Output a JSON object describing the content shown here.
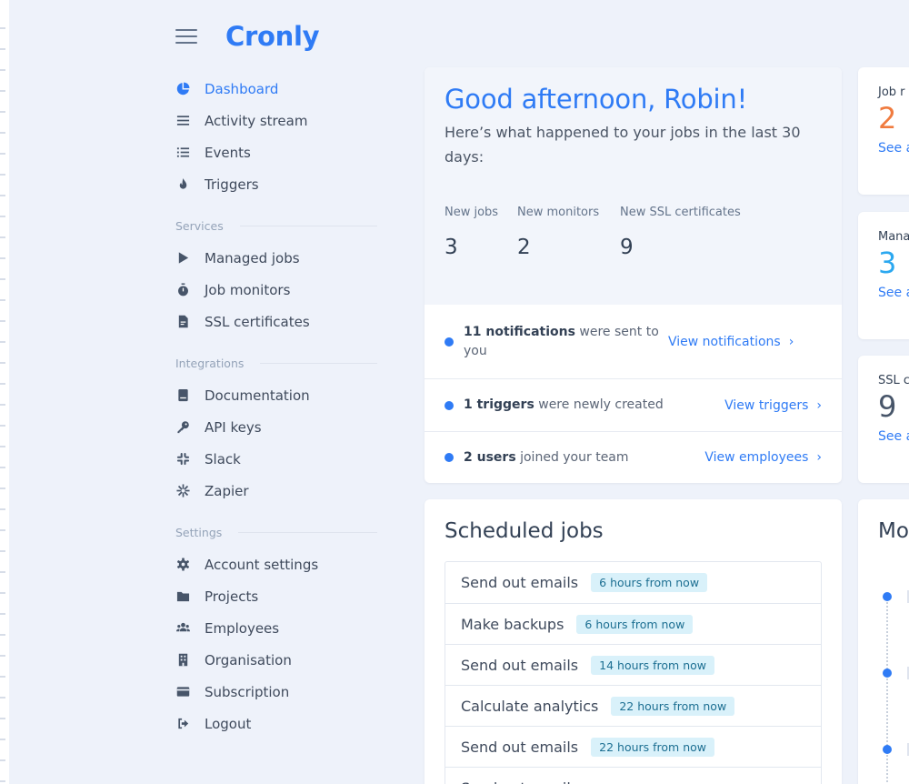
{
  "app": {
    "brand": "Cronly"
  },
  "sidebar": {
    "main": [
      {
        "label": "Dashboard",
        "icon": "pie-chart-icon",
        "active": true
      },
      {
        "label": "Activity stream",
        "icon": "list-icon"
      },
      {
        "label": "Events",
        "icon": "bulleted-list-icon"
      },
      {
        "label": "Triggers",
        "icon": "flame-icon"
      }
    ],
    "services_title": "Services",
    "services": [
      {
        "label": "Managed jobs",
        "icon": "play-icon"
      },
      {
        "label": "Job monitors",
        "icon": "stopwatch-icon"
      },
      {
        "label": "SSL certificates",
        "icon": "certificate-icon"
      }
    ],
    "integrations_title": "Integrations",
    "integrations": [
      {
        "label": "Documentation",
        "icon": "book-icon"
      },
      {
        "label": "API keys",
        "icon": "key-icon"
      },
      {
        "label": "Slack",
        "icon": "slack-icon"
      },
      {
        "label": "Zapier",
        "icon": "zapier-icon"
      }
    ],
    "settings_title": "Settings",
    "settings": [
      {
        "label": "Account settings",
        "icon": "gear-icon"
      },
      {
        "label": "Projects",
        "icon": "folder-icon"
      },
      {
        "label": "Employees",
        "icon": "users-icon"
      },
      {
        "label": "Organisation",
        "icon": "building-icon"
      },
      {
        "label": "Subscription",
        "icon": "credit-card-icon"
      },
      {
        "label": "Logout",
        "icon": "logout-icon"
      }
    ]
  },
  "welcome": {
    "greeting": "Good afternoon, Robin!",
    "subtitle": "Here’s what happened to your jobs in the last 30 days:",
    "stats": [
      {
        "label": "New jobs",
        "value": "3"
      },
      {
        "label": "New monitors",
        "value": "2"
      },
      {
        "label": "New SSL certificates",
        "value": "9"
      }
    ],
    "notifications": [
      {
        "bold": "11 notifications",
        "rest": " were sent to you",
        "link": "View notifications"
      },
      {
        "bold": "1 triggers",
        "rest": " were newly created",
        "link": "View triggers"
      },
      {
        "bold": "2 users",
        "rest": " joined your team",
        "link": "View employees"
      }
    ]
  },
  "scheduled": {
    "title": "Scheduled jobs",
    "jobs": [
      {
        "name": "Send out emails",
        "when": "6 hours from now"
      },
      {
        "name": "Make backups",
        "when": "6 hours from now"
      },
      {
        "name": "Send out emails",
        "when": "14 hours from now"
      },
      {
        "name": "Calculate analytics",
        "when": "22 hours from now"
      },
      {
        "name": "Send out emails",
        "when": "22 hours from now"
      },
      {
        "name": "Send out emails",
        "when": ""
      }
    ]
  },
  "side_cards": [
    {
      "title": "Job r",
      "value": "2",
      "color": "#f07b3f",
      "link": "See a"
    },
    {
      "title": "Mana",
      "value": "3",
      "color": "#2ba8f0",
      "link": "See a"
    },
    {
      "title": "SSL c",
      "value": "9",
      "color": "#475569",
      "link": "See a"
    }
  ],
  "monitors": {
    "title": "Mo"
  },
  "colors": {
    "accent": "#2f7bf5",
    "background": "#eef2fa",
    "badge_bg": "#d9f1fa"
  }
}
